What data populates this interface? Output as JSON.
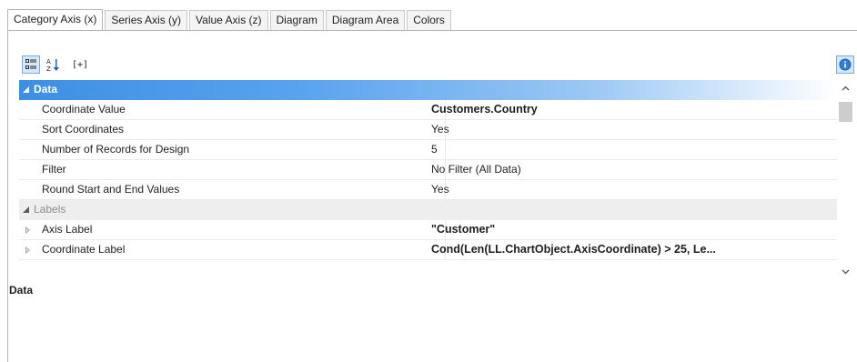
{
  "tabs": [
    {
      "label": "Category Axis (x)",
      "active": true
    },
    {
      "label": "Series Axis (y)",
      "active": false
    },
    {
      "label": "Value Axis (z)",
      "active": false
    },
    {
      "label": "Diagram",
      "active": false
    },
    {
      "label": "Diagram Area",
      "active": false
    },
    {
      "label": "Colors",
      "active": false
    }
  ],
  "toolbar": {
    "categorized_icon": "categorized-view-icon",
    "sort_icon": "sort-alphabetical-icon",
    "expand_label": "[+]",
    "info_icon": "info-icon"
  },
  "categories": {
    "data": {
      "title": "Data",
      "expanded": true
    },
    "labels": {
      "title": "Labels",
      "expanded": true
    }
  },
  "properties": [
    {
      "label": "Coordinate Value",
      "value": "Customers.Country",
      "bold": true
    },
    {
      "label": "Sort Coordinates",
      "value": "Yes",
      "bold": false
    },
    {
      "label": "Number of Records for Design",
      "value": "5",
      "bold": false
    },
    {
      "label": "Filter",
      "value": "No Filter (All Data)",
      "bold": false
    },
    {
      "label": "Round Start and End Values",
      "value": "Yes",
      "bold": false
    },
    {
      "label": "Axis Label",
      "value": "\"Customer\"",
      "bold": true
    },
    {
      "label": "Coordinate Label",
      "value": "Cond(Len(LL.ChartObject.AxisCoordinate) > 25, Le...",
      "bold": true
    }
  ],
  "description": {
    "title": "Data"
  },
  "colors": {
    "accent": "#3d8fe4",
    "category_bg": "#eeeeee",
    "border": "#b4b4b4"
  }
}
